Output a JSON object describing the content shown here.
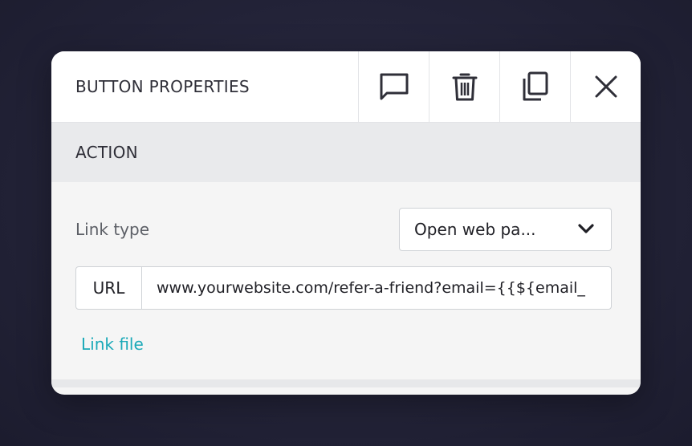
{
  "header": {
    "title": "BUTTON PROPERTIES",
    "actions": [
      {
        "name": "comment",
        "icon": "comment-icon"
      },
      {
        "name": "delete",
        "icon": "trash-icon"
      },
      {
        "name": "duplicate",
        "icon": "copy-icon"
      },
      {
        "name": "close",
        "icon": "close-icon"
      }
    ]
  },
  "section": {
    "title": "ACTION"
  },
  "link_type": {
    "label": "Link type",
    "selected": "Open web pa...",
    "icon": "chevron-down-icon"
  },
  "url": {
    "prefix": "URL",
    "value": "www.yourwebsite.com/refer-a-friend?email={{${email_"
  },
  "link_file": {
    "label": "Link file"
  },
  "colors": {
    "accent": "#1aa9b8",
    "panel": "#f5f5f5",
    "section_bar": "#e9eaec",
    "backdrop": "#232338"
  }
}
